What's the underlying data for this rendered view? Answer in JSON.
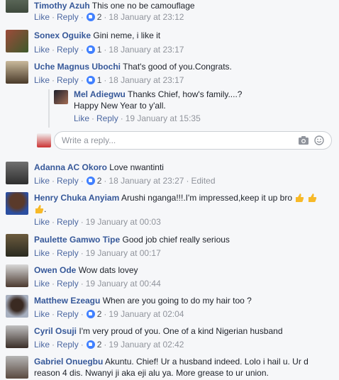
{
  "actions": {
    "like": "Like",
    "reply": "Reply",
    "sep": "·"
  },
  "reply_input": {
    "placeholder": "Write a reply..."
  },
  "comments": [
    {
      "name": "Timothy Azuh",
      "text": "This one no be camouflage",
      "reactions": "2",
      "time": "18 January at 23:12"
    },
    {
      "name": "Sonex Oguike",
      "text": "Gini neme, i like it",
      "reactions": "1",
      "time": "18 January at 23:17"
    },
    {
      "name": "Uche Magnus Ubochi",
      "text": "That's good of you.Congrats.",
      "reactions": "1",
      "time": "18 January at 23:17"
    },
    {
      "name": "Mel Adiegwu",
      "text": "Thanks Chief, how's family....?",
      "text2": "Happy New Year to y'all.",
      "time": "19 January at 15:35"
    },
    {
      "name": "Adanna AC Okoro",
      "text": "Love nwantinti",
      "reactions": "2",
      "time": "18 January at 23:27",
      "edited": "Edited"
    },
    {
      "name": "Henry Chuka Anyiam",
      "text": "Arushi nganga!!!.I'm impressed,keep it up bro",
      "text2": ".",
      "time": "19 January at 00:03"
    },
    {
      "name": "Paulette Gamwo Tipe",
      "text": "Good job chief really serious",
      "time": "19 January at 00:17"
    },
    {
      "name": "Owen Ode",
      "text": "Wow dats lovey",
      "time": "19 January at 00:44"
    },
    {
      "name": "Matthew Ezeagu",
      "text": "When are you going to do my hair too ?",
      "reactions": "2",
      "time": "19 January at 02:04"
    },
    {
      "name": "Cyril Osuji",
      "text": "I'm very proud of you. One of a kind Nigerian husband",
      "reactions": "2",
      "time": "19 January at 02:42"
    },
    {
      "name": "Gabriel Onuegbu",
      "text": "Akuntu. Chief! Ur a husband indeed. Lolo i hail u. Ur d",
      "text2": "reason 4 dis. Nwanyi ji aka eji alu ya. More grease to ur union."
    }
  ]
}
